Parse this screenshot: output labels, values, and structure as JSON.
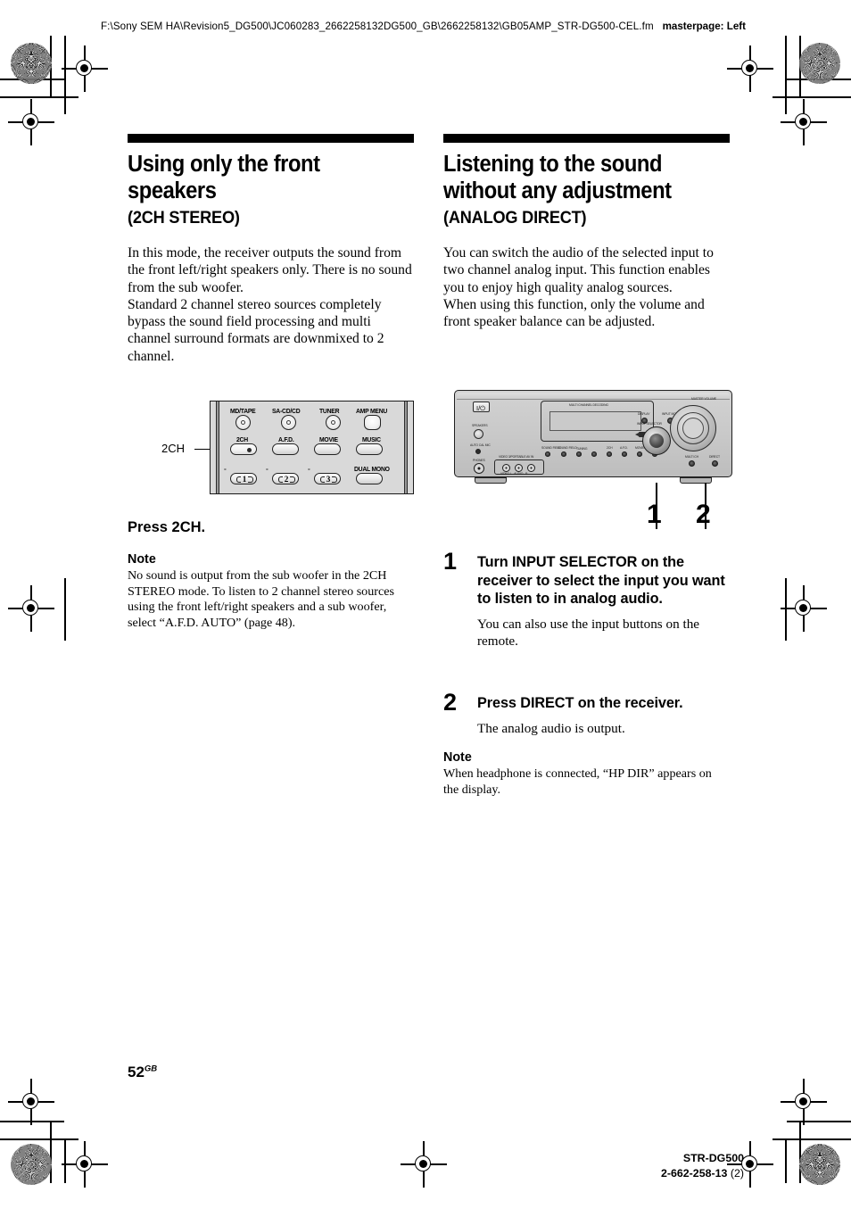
{
  "header": {
    "file_path": "F:\\Sony SEM HA\\Revision5_DG500\\JC060283_2662258132DG500_GB\\2662258132\\GB05AMP_STR-DG500-CEL.fm",
    "masterpage": "masterpage: Left"
  },
  "left_column": {
    "title": "Using only the front speakers",
    "subtitle": "(2CH STEREO)",
    "intro_paragraph_1": "In this mode, the receiver outputs the sound from the front left/right speakers only. There is no sound from the sub woofer.",
    "intro_paragraph_2": "Standard 2 channel stereo sources completely bypass the sound field processing and multi channel surround formats are downmixed to 2 channel.",
    "remote": {
      "callout_label": "2CH",
      "row1": [
        "MD/TAPE",
        "SA-CD/CD",
        "TUNER",
        "AMP MENU"
      ],
      "row2": [
        "2CH",
        "A.F.D.",
        "MOVIE",
        "MUSIC"
      ],
      "row3": [
        "1",
        "2",
        "3"
      ],
      "dual_mono_label": "DUAL MONO"
    },
    "instruction": "Press 2CH.",
    "note_heading": "Note",
    "note_body": "No sound is output from the sub woofer in the 2CH STEREO mode. To listen to 2 channel stereo sources using the front left/right speakers and a sub woofer, select “A.F.D. AUTO” (page 48)."
  },
  "right_column": {
    "title": "Listening to the sound without any adjustment",
    "subtitle": "(ANALOG DIRECT)",
    "intro_paragraph_1": "You can switch the audio of the selected input to two channel analog input. This function enables you to enjoy high quality analog sources.",
    "intro_paragraph_2": "When using this function, only the volume and front speaker balance can be adjusted.",
    "receiver": {
      "power_glyph": "I/⏻",
      "callout_1": "1",
      "callout_2": "2",
      "knob_labels": {
        "input_selector": "INPUT SELECTOR",
        "master_volume": "MASTER VOLUME",
        "display": "DISPLAY",
        "input_mode": "INPUT MODE",
        "multi_ch": "MULTI CH",
        "direct": "DIRECT",
        "speakers": "SPEAKERS",
        "auto_cal_mic": "AUTO CAL MIC",
        "phones": "PHONES",
        "video_audio_input": "VIDEO 3/PORTABLE AV IN",
        "video_l_audio_r": "VIDEO   L - AUDIO - R"
      },
      "mode_buttons": [
        "SOUND FIELD",
        "SOUND FIELD",
        "TUNING",
        "2CH",
        "A.F.D.",
        "MOVIE",
        "MUSIC"
      ],
      "display_text": "MULTI CHANNEL DECODING"
    },
    "steps": [
      {
        "number": "1",
        "title": "Turn INPUT SELECTOR on the receiver to select the input you want to listen to in analog audio.",
        "body": "You can also use the input buttons on the remote."
      },
      {
        "number": "2",
        "title": "Press DIRECT on the receiver.",
        "body": "The analog audio is output."
      }
    ],
    "note_heading": "Note",
    "note_body": "When headphone is connected, “HP DIR” appears on the display."
  },
  "footer": {
    "page_number": "52",
    "page_suffix": "GB",
    "model": "STR-DG500",
    "doc_number_prefix": "2-662-258-",
    "doc_number_bold": "13",
    "doc_number_suffix": " (2)"
  }
}
